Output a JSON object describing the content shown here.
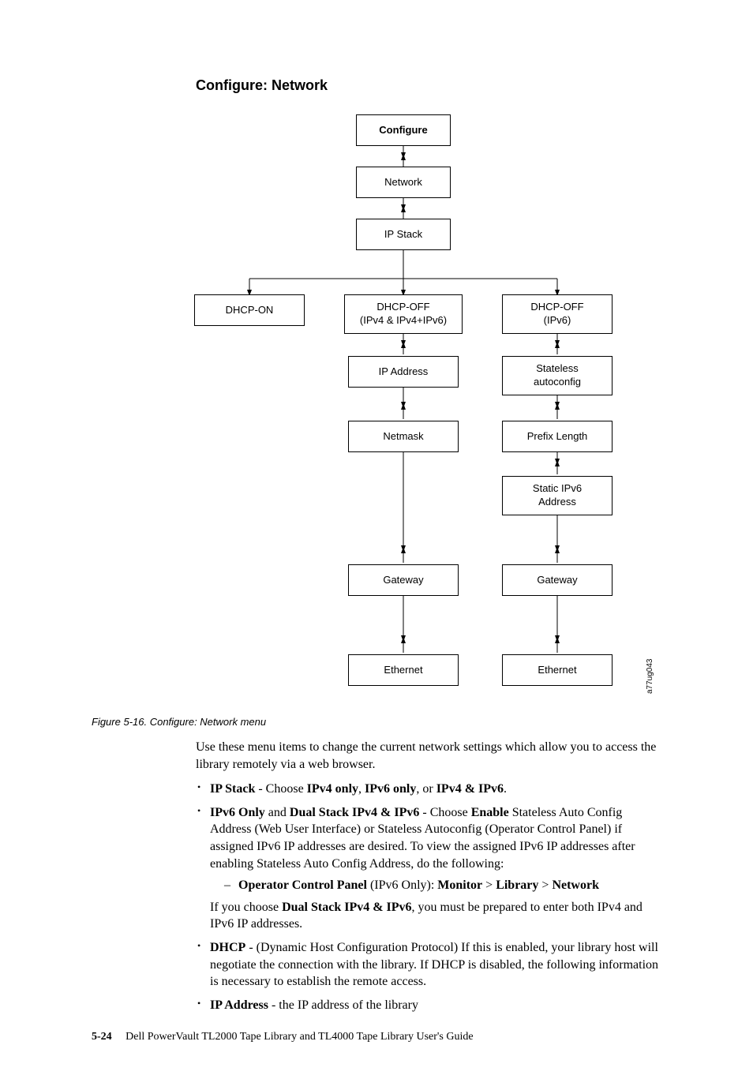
{
  "section_title": "Configure: Network",
  "diagram": {
    "configure": "Configure",
    "network": "Network",
    "ip_stack": "IP Stack",
    "dhcp_on": "DHCP-ON",
    "dhcp_off_v4": "DHCP-OFF\n(IPv4 & IPv4+IPv6)",
    "dhcp_off_v6": "DHCP-OFF\n(IPv6)",
    "ip_address": "IP Address",
    "stateless": "Stateless\nautoconfig",
    "netmask": "Netmask",
    "prefix_length": "Prefix Length",
    "static_ipv6": "Static IPv6\nAddress",
    "gateway_a": "Gateway",
    "gateway_b": "Gateway",
    "ethernet_a": "Ethernet",
    "ethernet_b": "Ethernet",
    "side_label": "a77ug043"
  },
  "figcap": "Figure 5-16. Configure: Network menu",
  "para_intro": "Use these menu items to change the current network settings which allow you to access the library remotely via a web browser.",
  "b_ipstack_label": "IP Stack",
  "b_ipstack_mid": " - Choose ",
  "b_ipstack_opt1": "IPv4 only",
  "b_ipstack_sep1": ", ",
  "b_ipstack_opt2": "IPv6 only",
  "b_ipstack_sep2": ", or ",
  "b_ipstack_opt3": "IPv4 & IPv6",
  "b_ipstack_end": ".",
  "b_ipv6_l1": "IPv6 Only",
  "b_ipv6_mid1": " and ",
  "b_ipv6_l2": "Dual Stack IPv4 & IPv6",
  "b_ipv6_mid2": " - Choose ",
  "b_ipv6_l3": "Enable",
  "b_ipv6_rest": " Stateless Auto Config Address (Web User Interface) or Stateless Autoconfig (Operator Control Panel) if assigned IPv6 IP addresses are desired. To view the assigned IPv6 IP addresses after enabling Stateless Auto Config Address, do the following:",
  "sub_ocp_l": "Operator Control Panel",
  "sub_ocp_mid": " (IPv6 Only): ",
  "sub_ocp_m": "Monitor",
  "sub_ocp_lib": "Library",
  "sub_ocp_net": "Network",
  "chev": " > ",
  "b_ipv6_post_pre": "If you choose ",
  "b_ipv6_post_b": "Dual Stack IPv4 & IPv6",
  "b_ipv6_post_rest": ", you must be prepared to enter both IPv4 and IPv6 IP addresses.",
  "b_dhcp_l": "DHCP",
  "b_dhcp_rest": " - (Dynamic Host Configuration Protocol) If this is enabled, your library host will negotiate the connection with the library. If DHCP is disabled, the following information is necessary to establish the remote access.",
  "b_ipaddr_l": "IP Address",
  "b_ipaddr_rest": " - the IP address of the library",
  "footer_page": "5-24",
  "footer_text": "Dell PowerVault TL2000 Tape Library and TL4000 Tape Library User's Guide"
}
